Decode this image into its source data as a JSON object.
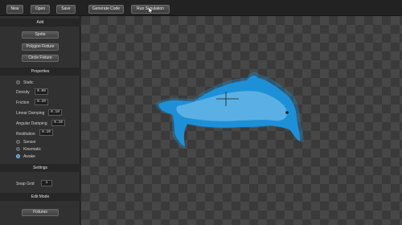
{
  "toolbar": {
    "new_label": "New",
    "open_label": "Open",
    "save_label": "Save",
    "generate_code_label": "Generate Code",
    "run_simulation_label": "Run Simulation"
  },
  "sidebar": {
    "add": {
      "title": "Add",
      "sprite_label": "Sprite",
      "polygon_fixture_label": "Polygon Fixture",
      "circle_fixture_label": "Circle Fixture"
    },
    "properties": {
      "title": "Properties",
      "static_label": "Static",
      "density_label": "Density",
      "density_value": "0.00",
      "friction_label": "Friction",
      "friction_value": "0.20",
      "linear_damping_label": "Linear Damping",
      "linear_damping_value": "0.10",
      "angular_damping_label": "Angular Damping",
      "angular_damping_value": "0.10",
      "restitution_label": "Restitution",
      "restitution_value": "0.10",
      "sensor_label": "Sensor",
      "kinematic_label": "Kinematic",
      "awake_label": "Awake",
      "selected_body_state": "Awake"
    },
    "settings": {
      "title": "Settings",
      "snap_grid_label": "Snap Grid",
      "snap_grid_value": "1"
    },
    "edit_mode": {
      "title": "Edit Mode",
      "fixtures_label": "Fixtures"
    }
  },
  "colors": {
    "dolphin": "#1e90d8",
    "fixture": "#5fb0e4",
    "selected_radio": "#2a8bd6",
    "canvas_dark": "#3a3a3a",
    "canvas_light": "#474747"
  }
}
